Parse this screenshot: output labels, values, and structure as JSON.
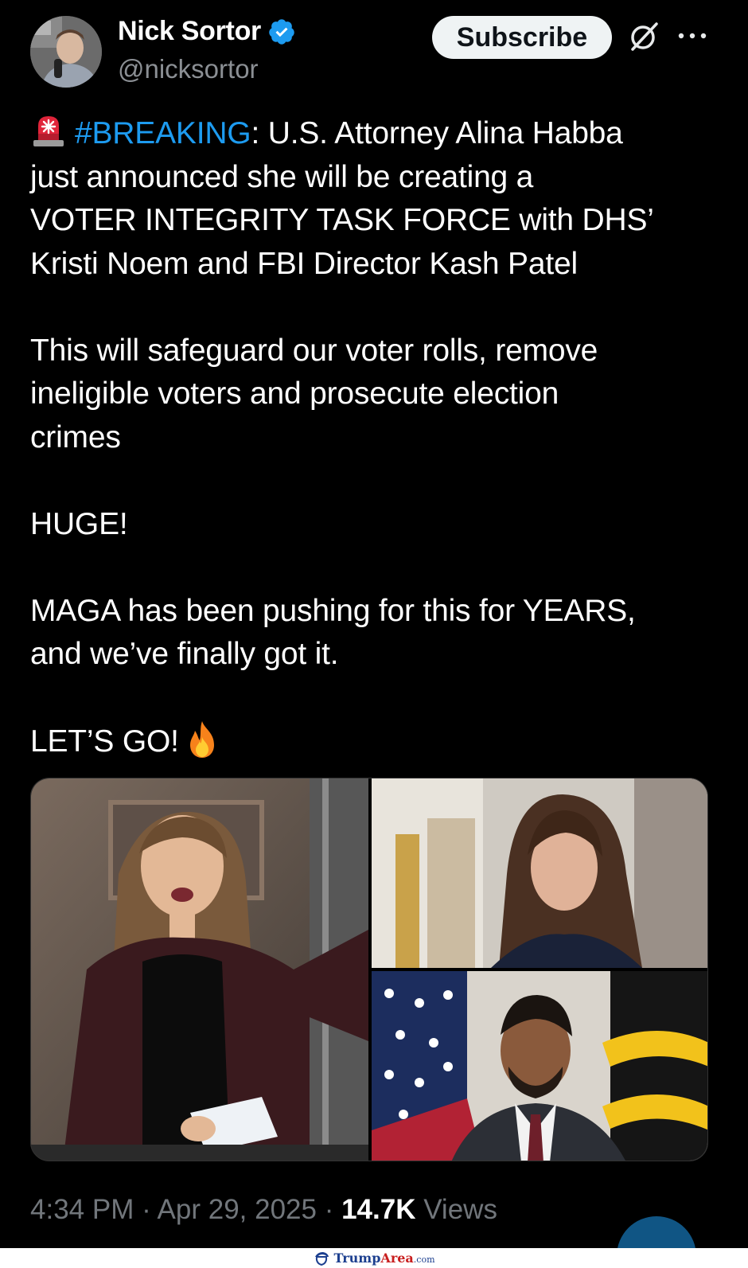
{
  "author": {
    "name": "Nick Sortor",
    "handle": "@nicksortor",
    "verified": true,
    "avatar_icon": "avatar-photo"
  },
  "actions": {
    "subscribe_label": "Subscribe",
    "grok_icon": "grok-icon",
    "more_icon": "more-options-icon"
  },
  "tweet": {
    "siren_icon": "police-siren-emoji",
    "hashtag": "#BREAKING",
    "line1_rest": ": U.S. Attorney Alina Habba",
    "line2": "just announced she will be creating a",
    "line3": "VOTER INTEGRITY TASK FORCE with DHS’",
    "line4": "Kristi Noem and FBI Director Kash Patel",
    "para2_line1": "This will safeguard our voter rolls, remove",
    "para2_line2": "ineligible voters and prosecute election",
    "para2_line3": "crimes",
    "para3": "HUGE!",
    "para4_line1": "MAGA has been pushing for this for YEARS,",
    "para4_line2": "and we’ve finally got it.",
    "para5": "LET’S GO!",
    "fire_icon": "fire-emoji"
  },
  "media": {
    "photos": [
      {
        "label": "woman-speaking-at-podium-photo"
      },
      {
        "label": "woman-portrait-photo"
      },
      {
        "label": "man-in-suit-with-flags-photo"
      }
    ]
  },
  "footer": {
    "time": "4:34 PM",
    "separator": " · ",
    "date": "Apr 29, 2025",
    "views_count": "14.7K",
    "views_label": " Views"
  },
  "watermark": {
    "brand_a": "Trump",
    "brand_b": "Area",
    "brand_c": ".com"
  },
  "colors": {
    "background": "#000000",
    "text": "#ffffff",
    "muted": "#71767b",
    "link": "#1d9bf0",
    "verified": "#1d9bf0",
    "button_bg": "#eff3f4"
  }
}
